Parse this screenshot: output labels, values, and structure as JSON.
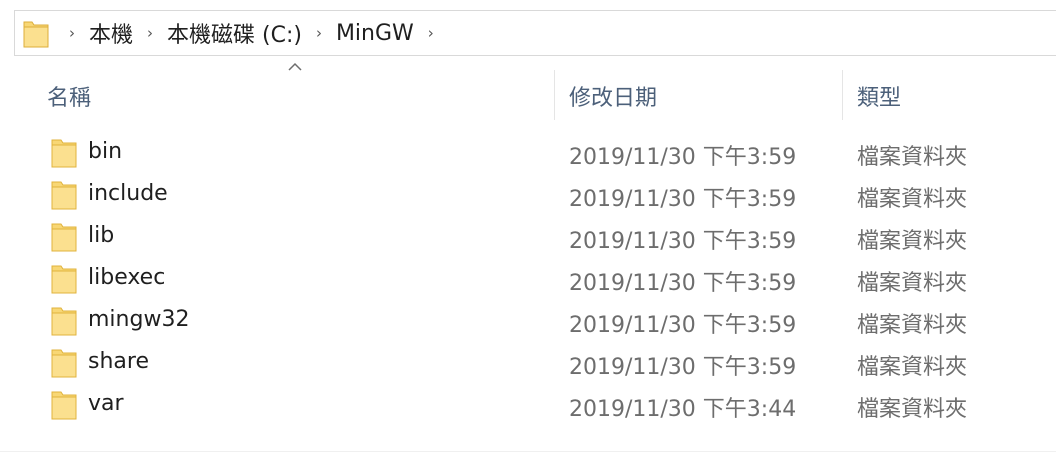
{
  "address_bar": {
    "crumbs": [
      "本機",
      "本機磁碟 (C:)",
      "MinGW"
    ],
    "separator": "›",
    "folder_icon": "folder-icon"
  },
  "columns": {
    "name": "名稱",
    "date_modified": "修改日期",
    "type": "類型",
    "sort": "name-ascending"
  },
  "files": [
    {
      "name": "bin",
      "date": "2019/11/30 下午3:59",
      "type": "檔案資料夾"
    },
    {
      "name": "include",
      "date": "2019/11/30 下午3:59",
      "type": "檔案資料夾"
    },
    {
      "name": "lib",
      "date": "2019/11/30 下午3:59",
      "type": "檔案資料夾"
    },
    {
      "name": "libexec",
      "date": "2019/11/30 下午3:59",
      "type": "檔案資料夾"
    },
    {
      "name": "mingw32",
      "date": "2019/11/30 下午3:59",
      "type": "檔案資料夾"
    },
    {
      "name": "share",
      "date": "2019/11/30 下午3:59",
      "type": "檔案資料夾"
    },
    {
      "name": "var",
      "date": "2019/11/30 下午3:44",
      "type": "檔案資料夾"
    }
  ],
  "colors": {
    "folder": "#f8d775",
    "folder_edge": "#e0b33c",
    "header_text": "#4c607a",
    "secondary_text": "#6d6d6d"
  }
}
